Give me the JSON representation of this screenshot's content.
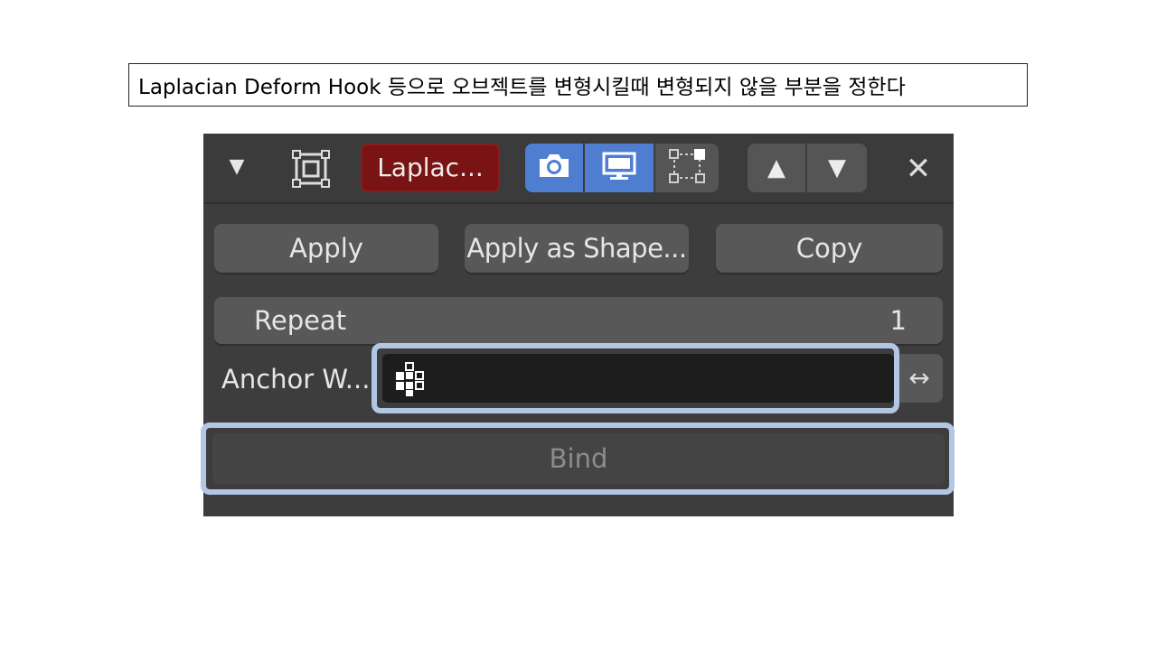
{
  "caption": "Laplacian Deform Hook 등으로 오브젝트를 변형시킬때 변형되지 않을 부분을 정한다",
  "modifier": {
    "collapse_glyph": "▼",
    "type_icon": "modifier-object-icon",
    "name": "Laplac...",
    "name_color": "#7a1313",
    "toggles": [
      {
        "icon": "camera-icon",
        "active": true
      },
      {
        "icon": "monitor-icon",
        "active": true
      },
      {
        "icon": "editmode-vertices-icon",
        "active": false
      }
    ],
    "accent": "#4f7ed1",
    "move_up": "▲",
    "move_down": "▼",
    "close": "✕"
  },
  "actions": {
    "apply": "Apply",
    "apply_shape": "Apply as Shape...",
    "copy": "Copy"
  },
  "repeat": {
    "label": "Repeat",
    "value": "1"
  },
  "anchor": {
    "label": "Anchor W...",
    "icon": "vertex-group-icon",
    "value": "",
    "invert_glyph": "↔"
  },
  "bind": {
    "label": "Bind"
  },
  "highlight_color": "#b3c6e3"
}
